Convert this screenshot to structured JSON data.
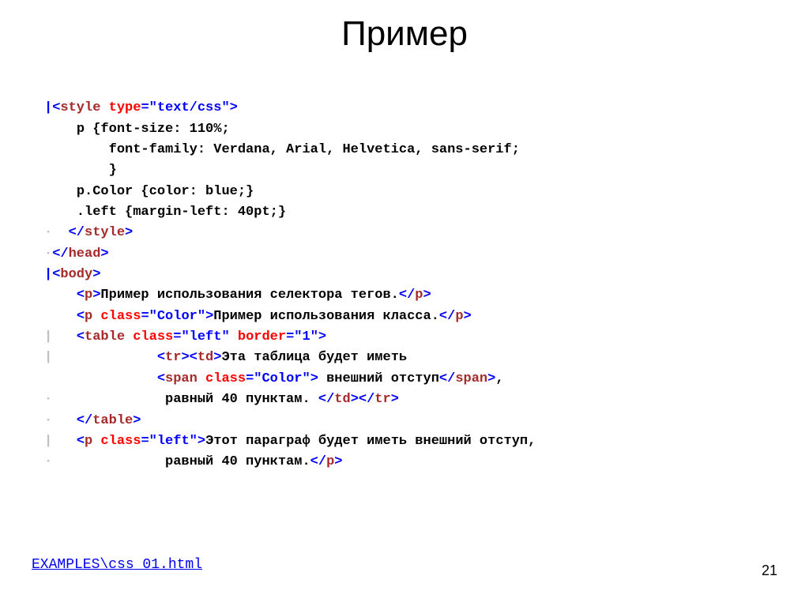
{
  "title": "Пример",
  "page_number": "21",
  "footer_link": "EXAMPLES\\css_01.html",
  "code": {
    "l1": {
      "open": "|<",
      "tag": "style",
      "sp": " ",
      "attr": "type",
      "eq": "=",
      "val": "\"text/css\"",
      "close": ">"
    },
    "l2": {
      "guide": "    ",
      "txt": "p {font-size: 110%;"
    },
    "l3": {
      "guide": "        ",
      "txt": "font-family: Verdana, Arial, Helvetica, sans-serif;"
    },
    "l4": {
      "guide": "        ",
      "txt": "}"
    },
    "l5": {
      "guide": "    ",
      "txt": "p.Color {color: blue;}"
    },
    "l6": {
      "guide": "    ",
      "txt": ".left {margin-left: 40pt;}"
    },
    "l7": {
      "dot": "·  ",
      "open": "</",
      "tag": "style",
      "close": ">"
    },
    "l8": {
      "dot": "·",
      "open": "</",
      "tag": "head",
      "close": ">"
    },
    "l9": {
      "open": "|<",
      "tag": "body",
      "close": ">"
    },
    "l10": {
      "guide": "    ",
      "open": "<",
      "tag": "p",
      "close": ">",
      "txt": "Пример использования селектора тегов.",
      "open2": "</",
      "tag2": "p",
      "close2": ">"
    },
    "l11": {
      "guide": "    ",
      "open": "<",
      "tag": "p",
      "sp": " ",
      "attr": "class",
      "eq": "=",
      "val": "\"Color\"",
      "close": ">",
      "txt": "Пример использования класса.",
      "open2": "</",
      "tag2": "p",
      "close2": ">"
    },
    "l12": {
      "guide": "|   ",
      "open": "<",
      "tag": "table",
      "sp": " ",
      "attr": "class",
      "eq": "=",
      "val": "\"left\"",
      "sp2": " ",
      "attr2": "border",
      "eq2": "=",
      "val2": "\"1\"",
      "close": ">"
    },
    "l13": {
      "guide": "|             ",
      "open": "<",
      "tag": "tr",
      "close": ">",
      "open2": "<",
      "tag2": "td",
      "close2": ">",
      "txt": "Эта таблица будет иметь"
    },
    "l14": {
      "guide": "              ",
      "open": "<",
      "tag": "span",
      "sp": " ",
      "attr": "class",
      "eq": "=",
      "val": "\"Color\"",
      "close": ">",
      "txt": " внешний отступ",
      "open2": "</",
      "tag2": "span",
      "close2": ">",
      "txt2": ","
    },
    "l15": {
      "dot": "·             ",
      "txt": " равный 40 пунктам. ",
      "open": "</",
      "tag": "td",
      "close": ">",
      "open2": "</",
      "tag2": "tr",
      "close2": ">"
    },
    "l16": {
      "dot": "·   ",
      "open": "</",
      "tag": "table",
      "close": ">"
    },
    "l17": {
      "guide": "|   ",
      "open": "<",
      "tag": "p",
      "sp": " ",
      "attr": "class",
      "eq": "=",
      "val": "\"left\"",
      "close": ">",
      "txt": "Этот параграф будет иметь внешний отступ,"
    },
    "l18": {
      "dot": "·             ",
      "txt": " равный 40 пунктам.",
      "open": "</",
      "tag": "p",
      "close": ">"
    }
  }
}
